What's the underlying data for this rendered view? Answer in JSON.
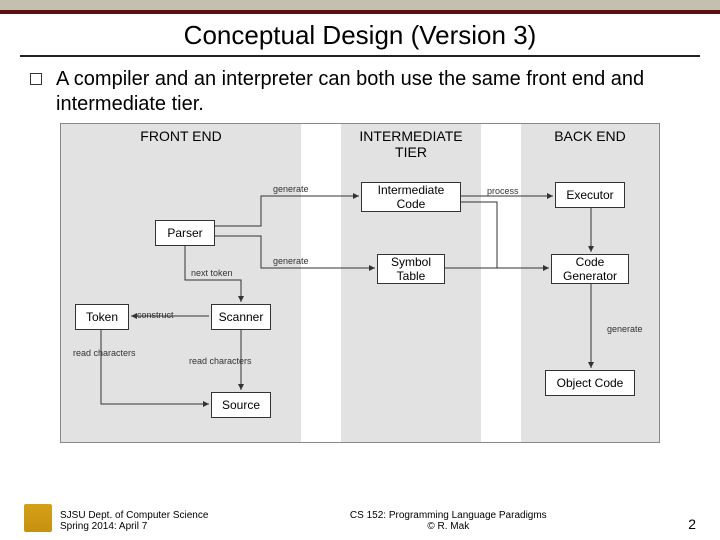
{
  "title": "Conceptual Design (Version 3)",
  "bullet": "A compiler and an interpreter can both use the same front end and intermediate tier.",
  "tiers": {
    "fe": "FRONT END",
    "mt": "INTERMEDIATE\nTIER",
    "be": "BACK END"
  },
  "boxes": {
    "parser": "Parser",
    "scanner": "Scanner",
    "token": "Token",
    "source": "Source",
    "icode": "Intermediate\nCode",
    "symtab": "Symbol\nTable",
    "executor": "Executor",
    "codegen": "Code\nGenerator",
    "objcode": "Object Code"
  },
  "edges": {
    "generate1": "generate",
    "generate2": "generate",
    "next_token": "next token",
    "construct": "construct",
    "read1": "read characters",
    "read2": "read characters",
    "process": "process",
    "generate3": "generate"
  },
  "footer": {
    "dept": "SJSU Dept. of Computer Science",
    "term": "Spring 2014: April 7",
    "course": "CS 152: Programming Language Paradigms",
    "copyright": "© R. Mak",
    "page": "2"
  }
}
